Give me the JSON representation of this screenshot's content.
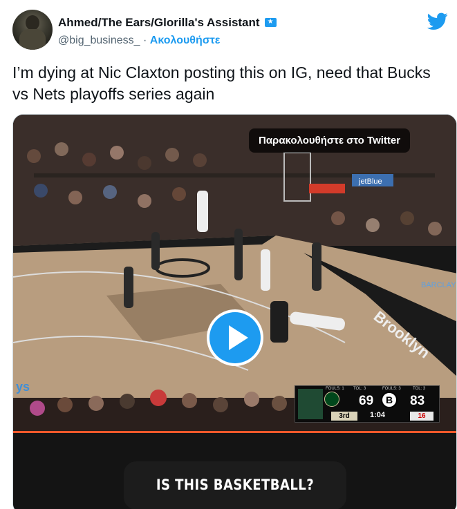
{
  "author": {
    "display_name": "Ahmed/The Ears/Glorilla's Assistant",
    "handle": "@big_business_",
    "separator": "·",
    "follow_label": "Ακολουθήστε",
    "verified_icon": "verified-badge-icon"
  },
  "brand_icon": "twitter-bird-icon",
  "tweet": {
    "text": "I’m dying at Nic Claxton posting this on IG, need that Bucks vs Nets playoffs series again"
  },
  "media": {
    "watch_label": "Παρακολουθήστε στο Twitter",
    "play_icon": "play-icon",
    "caption": "IS THIS BASKETBALL?",
    "scorebug": {
      "mil_fouls": "FOULS: 1",
      "mil_tol": "TOL: 3",
      "mil_score": "69",
      "bkn_fouls": "FOULS: 3",
      "bkn_tol": "TOL: 3",
      "bkn_score": "83",
      "quarter": "3rd",
      "clock": "1:04",
      "shot_clock": "16"
    },
    "court_text": [
      "jetBlue",
      "Brooklyn",
      "BARCLAYS"
    ]
  },
  "colors": {
    "accent": "#1d9bf0",
    "text": "#0f1419",
    "secondary": "#536471",
    "progress": "#f0582a"
  }
}
